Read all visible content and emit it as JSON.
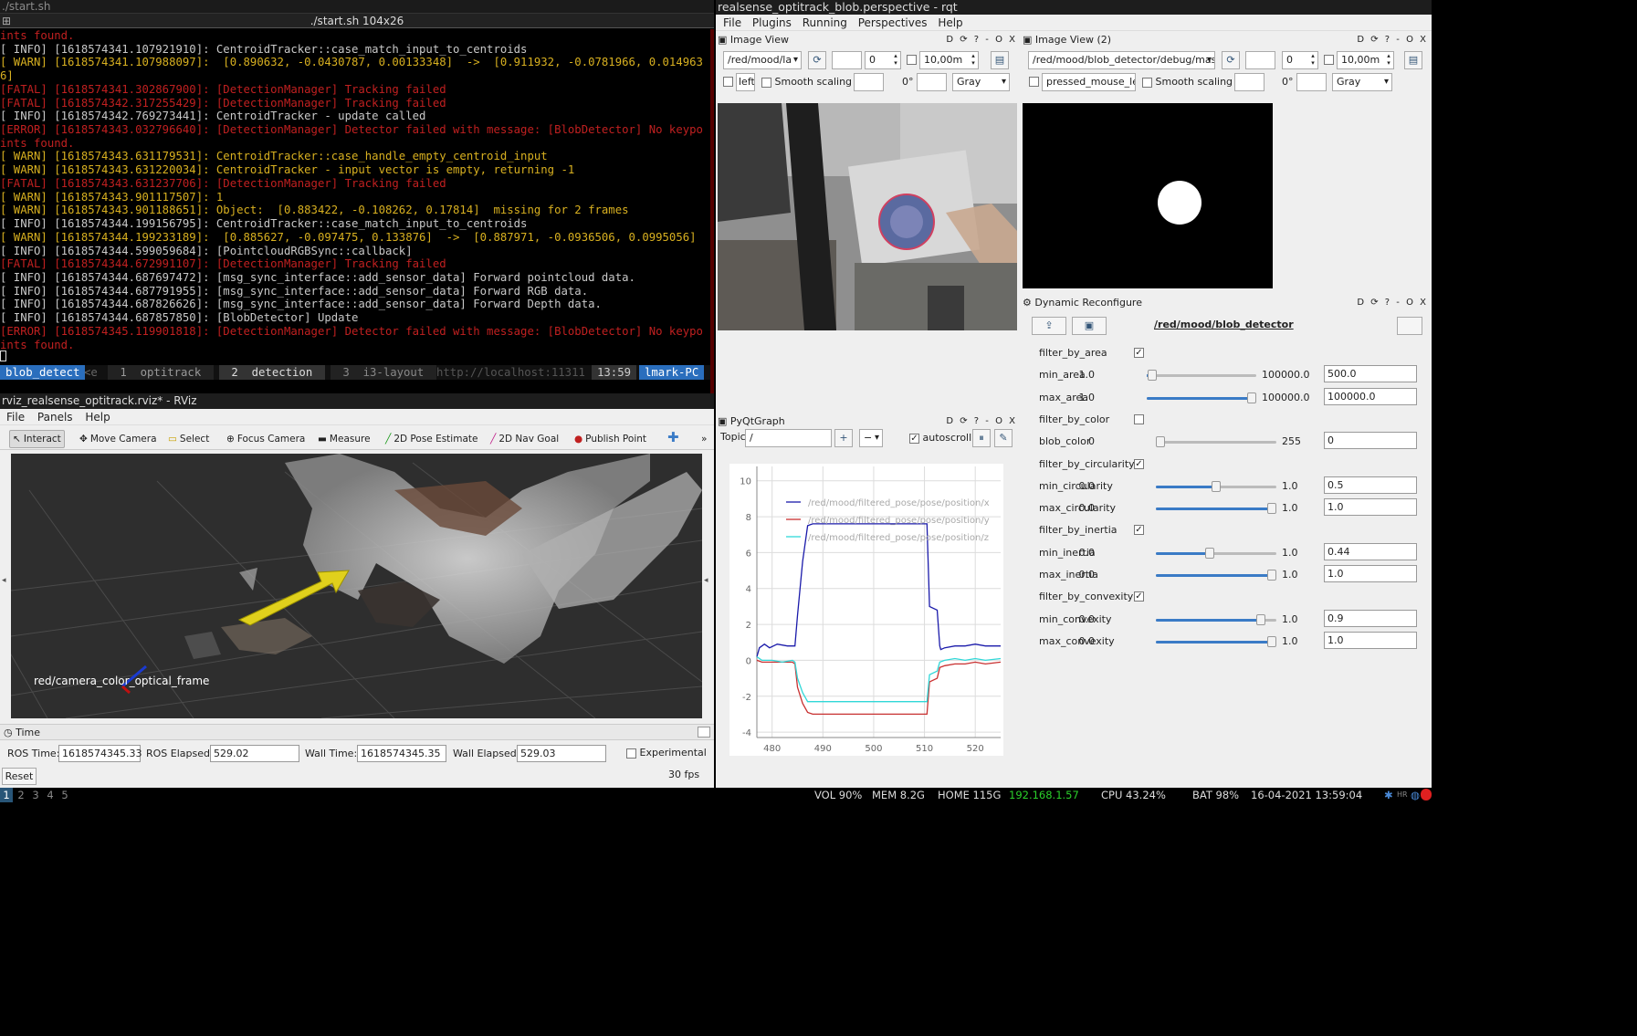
{
  "terminal": {
    "window_title": "./start.sh",
    "title": "./start.sh 104x26",
    "lines": [
      {
        "text": "ints found.",
        "color": "#c02020"
      },
      {
        "text": "[ INFO] [1618574341.107921910]: CentroidTracker::case_match_input_to_centroids",
        "color": "#c8c8c8"
      },
      {
        "text": "[ WARN] [1618574341.107988097]:  [0.890632, -0.0430787, 0.00133348]  ->  [0.911932, -0.0781966, 0.014963",
        "color": "#d8b020"
      },
      {
        "text": "6]",
        "color": "#d8b020"
      },
      {
        "text": "[FATAL] [1618574341.302867900]: [DetectionManager] Tracking failed",
        "color": "#c02020"
      },
      {
        "text": "[FATAL] [1618574342.317255429]: [DetectionManager] Tracking failed",
        "color": "#c02020"
      },
      {
        "text": "[ INFO] [1618574342.769273441]: CentroidTracker - update called",
        "color": "#c8c8c8"
      },
      {
        "text": "[ERROR] [1618574343.032796640]: [DetectionManager] Detector failed with message: [BlobDetector] No keypo",
        "color": "#c02020"
      },
      {
        "text": "ints found.",
        "color": "#c02020"
      },
      {
        "text": "[ WARN] [1618574343.631179531]: CentroidTracker::case_handle_empty_centroid_input",
        "color": "#d8b020"
      },
      {
        "text": "[ WARN] [1618574343.631220034]: CentroidTracker - input vector is empty, returning -1",
        "color": "#d8b020"
      },
      {
        "text": "[FATAL] [1618574343.631237706]: [DetectionManager] Tracking failed",
        "color": "#c02020"
      },
      {
        "text": "[ WARN] [1618574343.901117507]: 1",
        "color": "#d8b020"
      },
      {
        "text": "[ WARN] [1618574343.901188651]: Object:  [0.883422, -0.108262, 0.17814]  missing for 2 frames",
        "color": "#d8b020"
      },
      {
        "text": "[ INFO] [1618574344.199156795]: CentroidTracker::case_match_input_to_centroids",
        "color": "#c8c8c8"
      },
      {
        "text": "[ WARN] [1618574344.199233189]:  [0.885627, -0.097475, 0.133876]  ->  [0.887971, -0.0936506, 0.0995056]",
        "color": "#d8b020"
      },
      {
        "text": "[ INFO] [1618574344.599059684]: [PointcloudRGBSync::callback]",
        "color": "#c8c8c8"
      },
      {
        "text": "[FATAL] [1618574344.672991107]: [DetectionManager] Tracking failed",
        "color": "#c02020"
      },
      {
        "text": "[ INFO] [1618574344.687697472]: [msg_sync_interface::add_sensor_data] Forward pointcloud data.",
        "color": "#c8c8c8"
      },
      {
        "text": "[ INFO] [1618574344.687791955]: [msg_sync_interface::add_sensor_data] Forward RGB data.",
        "color": "#c8c8c8"
      },
      {
        "text": "[ INFO] [1618574344.687826626]: [msg_sync_interface::add_sensor_data] Forward Depth data.",
        "color": "#c8c8c8"
      },
      {
        "text": "[ INFO] [1618574344.687857850]: [BlobDetector] Update",
        "color": "#c8c8c8"
      },
      {
        "text": "[ERROR] [1618574345.119901818]: [DetectionManager] Detector failed with message: [BlobDetector] No keypo",
        "color": "#c02020"
      },
      {
        "text": "ints found.",
        "color": "#c02020"
      }
    ],
    "tmux": {
      "session": "blob_detect",
      "marker": "<e",
      "w1": " 1  optitrack ",
      "w2": " 2  detection ",
      "w3": " 3  i3-layout ",
      "url": "http://localhost:11311",
      "clock": "13:59",
      "host": "lmark-PC"
    }
  },
  "rviz": {
    "title": "rviz_realsense_optitrack.rviz* - RViz",
    "menu": [
      "File",
      "Panels",
      "Help"
    ],
    "tools": [
      "Interact",
      "Move Camera",
      "Select",
      "Focus Camera",
      "Measure",
      "2D Pose Estimate",
      "2D Nav Goal",
      "Publish Point"
    ],
    "overflow": "»",
    "frame_label": "red/camera_color_optical_frame",
    "time": {
      "header": "Time",
      "ros_time_label": "ROS Time:",
      "ros_time": "1618574345.33",
      "ros_elapsed_label": "ROS Elapsed:",
      "ros_elapsed": "529.02",
      "wall_time_label": "Wall Time:",
      "wall_time": "1618574345.35",
      "wall_elapsed_label": "Wall Elapsed:",
      "wall_elapsed": "529.03",
      "experimental": "Experimental",
      "reset": "Reset",
      "fps": "30 fps"
    }
  },
  "rqt": {
    "title": "realsense_optitrack_blob.perspective - rqt",
    "menu": [
      "File",
      "Plugins",
      "Running",
      "Perspectives",
      "Help"
    ],
    "image_view_1": {
      "title": "Image View",
      "topic": "/red/mood/la",
      "num": "0",
      "dist": "10,00m",
      "mouse": "left",
      "smooth": "Smooth scaling",
      "angle": "0°",
      "color": "Gray"
    },
    "image_view_2": {
      "title": "Image View (2)",
      "topic": "/red/mood/blob_detector/debug/mask",
      "num": "0",
      "dist": "10,00m",
      "mouse": "pressed_mouse_left",
      "smooth": "Smooth scaling",
      "angle": "0°",
      "color": "Gray"
    },
    "panel_ctl": "D ⟳ ? - O X",
    "dynamic": {
      "title": "Dynamic Reconfigure",
      "node": "/red/mood/blob_detector",
      "params": [
        {
          "name": "filter_by_area",
          "kind": "bool",
          "checked": true
        },
        {
          "name": "min_area",
          "kind": "num",
          "min": "1.0",
          "max": "100000.0",
          "value": "500.0",
          "frac": 0.005
        },
        {
          "name": "max_area",
          "kind": "num",
          "min": "1.0",
          "max": "100000.0",
          "value": "100000.0",
          "frac": 1.0
        },
        {
          "name": "filter_by_color",
          "kind": "bool",
          "checked": false
        },
        {
          "name": "blob_color",
          "kind": "num",
          "min": "0",
          "max": "255",
          "value": "0",
          "frac": 0.0
        },
        {
          "name": "filter_by_circularity",
          "kind": "bool",
          "checked": true
        },
        {
          "name": "min_circularity",
          "kind": "num",
          "min": "0.0",
          "max": "1.0",
          "value": "0.5",
          "frac": 0.5
        },
        {
          "name": "max_circularity",
          "kind": "num",
          "min": "0.0",
          "max": "1.0",
          "value": "1.0",
          "frac": 1.0
        },
        {
          "name": "filter_by_inertia",
          "kind": "bool",
          "checked": true
        },
        {
          "name": "min_inertia",
          "kind": "num",
          "min": "0.0",
          "max": "1.0",
          "value": "0.44",
          "frac": 0.44
        },
        {
          "name": "max_inertia",
          "kind": "num",
          "min": "0.0",
          "max": "1.0",
          "value": "1.0",
          "frac": 1.0
        },
        {
          "name": "filter_by_convexity",
          "kind": "bool",
          "checked": true
        },
        {
          "name": "min_convexity",
          "kind": "num",
          "min": "0.0",
          "max": "1.0",
          "value": "0.9",
          "frac": 0.9
        },
        {
          "name": "max_convexity",
          "kind": "num",
          "min": "0.0",
          "max": "1.0",
          "value": "1.0",
          "frac": 1.0
        }
      ]
    },
    "pyqtgraph": {
      "title": "PyQtGraph",
      "topic_label": "Topic",
      "topic_value": "/",
      "autoscroll": "autoscroll"
    }
  },
  "chart_data": {
    "type": "line",
    "xlim": [
      477,
      525
    ],
    "ylim": [
      -4.3,
      10.8
    ],
    "x_ticks": [
      480,
      490,
      500,
      510,
      520
    ],
    "y_ticks": [
      -4,
      -2,
      0,
      2,
      4,
      6,
      8,
      10
    ],
    "grid": true,
    "legend_position": "top-right",
    "series": [
      {
        "name": "/red/mood/filtered_pose/pose/position/x",
        "color": "#1a1aaa",
        "x": [
          477,
          477.5,
          478.5,
          479.5,
          481,
          483,
          484.5,
          485,
          486,
          487,
          488,
          490,
          500,
          508,
          510.5,
          511,
          512.5,
          513,
          513.2,
          514,
          516,
          518,
          520,
          522,
          525
        ],
        "y": [
          0.2,
          0.7,
          0.9,
          0.7,
          0.9,
          0.8,
          0.8,
          2.5,
          5.5,
          7.5,
          7.6,
          7.6,
          7.6,
          7.6,
          7.6,
          3.0,
          2.8,
          0.8,
          0.6,
          0.7,
          0.8,
          0.8,
          0.9,
          0.8,
          0.8
        ]
      },
      {
        "name": "/red/mood/filtered_pose/pose/position/y",
        "color": "#c83030",
        "x": [
          477,
          478,
          480,
          482,
          484,
          484.5,
          485,
          486,
          487,
          488,
          490,
          500,
          508,
          510.5,
          511,
          512.5,
          513,
          514,
          516,
          518,
          520,
          522,
          525
        ],
        "y": [
          0.0,
          -0.1,
          -0.1,
          -0.1,
          -0.1,
          -0.2,
          -1.5,
          -2.4,
          -2.9,
          -3.0,
          -3.0,
          -3.0,
          -3.0,
          -3.0,
          -1.2,
          -1.0,
          -0.4,
          -0.3,
          -0.2,
          -0.2,
          -0.1,
          -0.2,
          -0.1
        ]
      },
      {
        "name": "/red/mood/filtered_pose/pose/position/z",
        "color": "#30d8d8",
        "x": [
          477,
          478,
          480,
          482,
          484,
          484.5,
          485,
          486,
          487,
          488,
          490,
          500,
          508,
          510.5,
          511,
          512.5,
          513,
          514,
          516,
          518,
          520,
          522,
          525
        ],
        "y": [
          0.2,
          0.0,
          0.0,
          -0.1,
          0.0,
          -0.1,
          -1.0,
          -1.8,
          -2.3,
          -2.3,
          -2.3,
          -2.3,
          -2.3,
          -2.3,
          -0.8,
          -0.6,
          -0.1,
          0.0,
          0.1,
          0.0,
          0.1,
          0.0,
          0.1
        ]
      }
    ]
  },
  "statusbar": {
    "workspaces": [
      "1",
      "2",
      "3",
      "4",
      "5"
    ],
    "vol": "VOL 90%",
    "mem": "MEM 8.2G",
    "home": "HOME 115G",
    "ip": "192.168.1.57",
    "cpu": "CPU 43.24%",
    "bat": "BAT 98%",
    "datetime": "16-04-2021 13:59:04"
  }
}
